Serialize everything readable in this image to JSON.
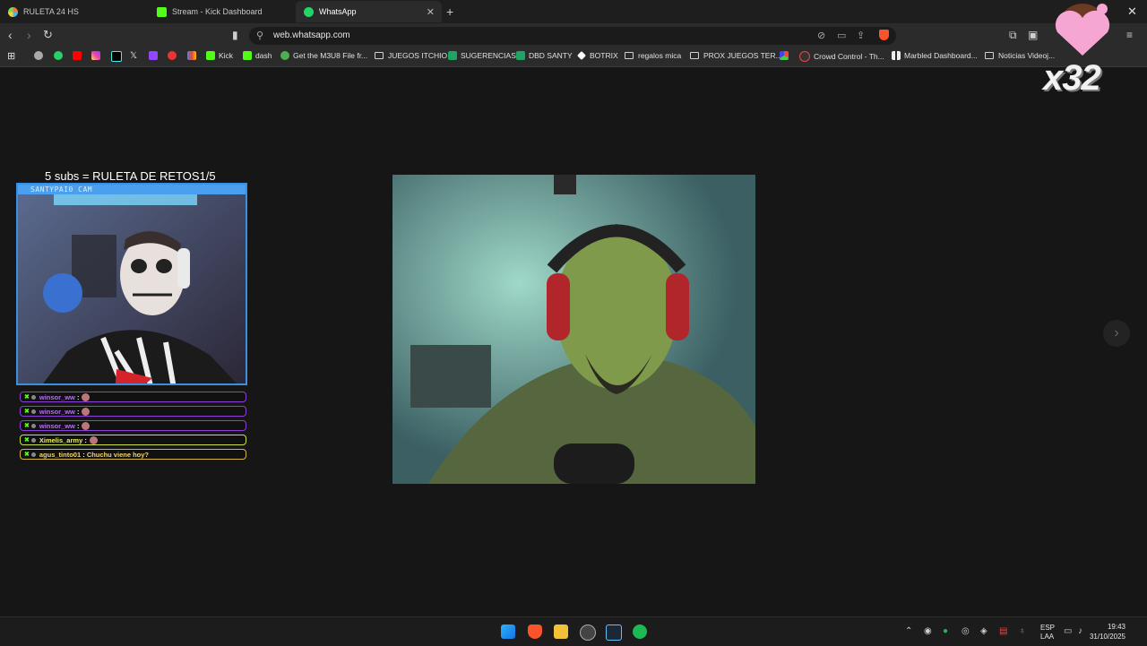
{
  "tabs": [
    {
      "label": "RULETA 24 HS",
      "active": false,
      "icon": "colorful-star-icon"
    },
    {
      "label": "Stream - Kick Dashboard",
      "active": false,
      "icon": "kick-icon"
    },
    {
      "label": "WhatsApp",
      "active": true,
      "icon": "whatsapp-icon"
    }
  ],
  "toolbar": {
    "url": "web.whatsapp.com"
  },
  "bookmarks": [
    {
      "label": "Kick",
      "type": "kick"
    },
    {
      "label": "dash",
      "type": "kick"
    },
    {
      "label": "Get the M3U8 File fr...",
      "type": "site"
    },
    {
      "label": "JUEGOS ITCHIO",
      "type": "folder"
    },
    {
      "label": "SUGERENCIAS",
      "type": "sheet"
    },
    {
      "label": "DBD SANTY",
      "type": "sheet"
    },
    {
      "label": "BOTRIX",
      "type": "site"
    },
    {
      "label": "regalos mica",
      "type": "folder"
    },
    {
      "label": "PROX JUEGOS TER...",
      "type": "folder"
    },
    {
      "label": "Crowd Control - Th...",
      "type": "site"
    },
    {
      "label": "Marbled Dashboard...",
      "type": "site"
    },
    {
      "label": "Noticias Videoj...",
      "type": "folder"
    }
  ],
  "overlay": {
    "title": "5 subs = RULETA DE RETOS1/5",
    "cam_label": "SANTYPAI0 CAM",
    "counter": "x32"
  },
  "chat": [
    {
      "user": "winsor_ww",
      "message": "",
      "color": "#b86cff"
    },
    {
      "user": "winsor_ww",
      "message": "",
      "color": "#b86cff"
    },
    {
      "user": "winsor_ww",
      "message": "",
      "color": "#b86cff"
    },
    {
      "user": "Ximelis_army",
      "message": "",
      "color": "#e7f35b"
    },
    {
      "user": "agus_tinto01",
      "message": "Chuchu viene hoy?",
      "color": "#f5d46a"
    }
  ],
  "taskbar": {
    "lang_top": "ESP",
    "lang_bottom": "LAA",
    "time": "19:43",
    "date": "31/10/2025"
  }
}
